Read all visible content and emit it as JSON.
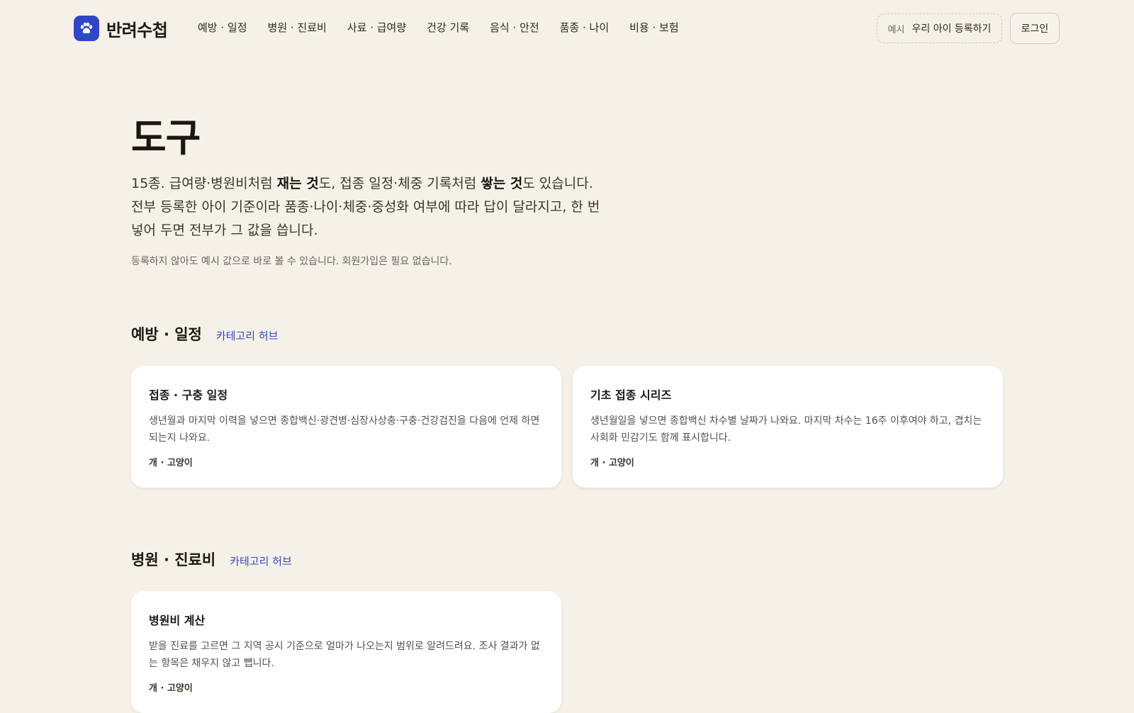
{
  "header": {
    "brand": "반려수첩",
    "logo_icon": "paw-icon",
    "nav": [
      "예방 · 일정",
      "병원 · 진료비",
      "사료 · 급여량",
      "건강 기록",
      "음식 · 안전",
      "품종 · 나이",
      "비용 · 보험"
    ],
    "demo_tag": "예시",
    "demo_label": "우리 아이 등록하기",
    "login": "로그인"
  },
  "hero": {
    "title": "도구",
    "desc_1": "15종. 급여량·병원비처럼 ",
    "desc_bold_1": "재는 것",
    "desc_2": "도, 접종 일정·체중 기록처럼 ",
    "desc_bold_2": "쌓는 것",
    "desc_3": "도 있습니다. 전부 등록한 아이 기준이라 품종·나이·체중·중성화 여부에 따라 답이 달라지고, 한 번 넣어 두면 전부가 그 값을 씁니다.",
    "note": "등록하지 않아도 예시 값으로 바로 볼 수 있습니다. 회원가입은 필요 없습니다."
  },
  "sections": [
    {
      "title": "예방 · 일정",
      "link": "카테고리 허브",
      "cards": [
        {
          "title": "접종 · 구충 일정",
          "desc": "생년월과 마지막 이력을 넣으면 종합백신·광견병·심장사상충·구충·건강검진을 다음에 언제 하면 되는지 나와요.",
          "tag": "개 · 고양이"
        },
        {
          "title": "기초 접종 시리즈",
          "desc": "생년월일을 넣으면 종합백신 차수별 날짜가 나와요. 마지막 차수는 16주 이후여야 하고, 겹치는 사회화 민감기도 함께 표시합니다.",
          "tag": "개 · 고양이"
        }
      ]
    },
    {
      "title": "병원 · 진료비",
      "link": "카테고리 허브",
      "cards": [
        {
          "title": "병원비 계산",
          "desc": "받을 진료를 고르면 그 지역 공시 기준으로 얼마가 나오는지 범위로 알려드려요. 조사 결과가 없는 항목은 채우지 않고 뺍니다.",
          "tag": "개 · 고양이"
        }
      ]
    }
  ]
}
